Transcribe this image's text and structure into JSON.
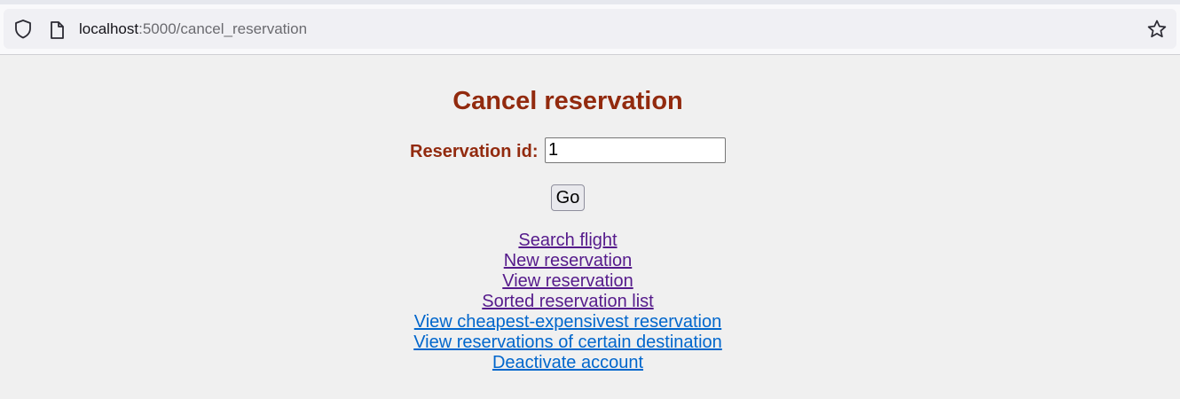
{
  "browser": {
    "url_host": "localhost",
    "url_path": ":5000/cancel_reservation",
    "icons": [
      "shield-icon",
      "page-icon",
      "star-icon"
    ]
  },
  "page": {
    "title": "Cancel reservation",
    "form": {
      "label": "Reservation id:",
      "input_value": "1",
      "submit_label": "Go"
    },
    "links": [
      {
        "label": "Search flight",
        "visited": true
      },
      {
        "label": "New reservation",
        "visited": true
      },
      {
        "label": "View reservation",
        "visited": true
      },
      {
        "label": "Sorted reservation list",
        "visited": true
      },
      {
        "label": "View cheapest-expensivest reservation",
        "visited": false
      },
      {
        "label": "View reservations of certain destination",
        "visited": false
      },
      {
        "label": "Deactivate account",
        "visited": false
      }
    ]
  },
  "colors": {
    "heading": "#922a0e",
    "visited_link": "#551a8b",
    "unvisited_link": "#0066cc",
    "page_background": "#f0f0f0"
  }
}
